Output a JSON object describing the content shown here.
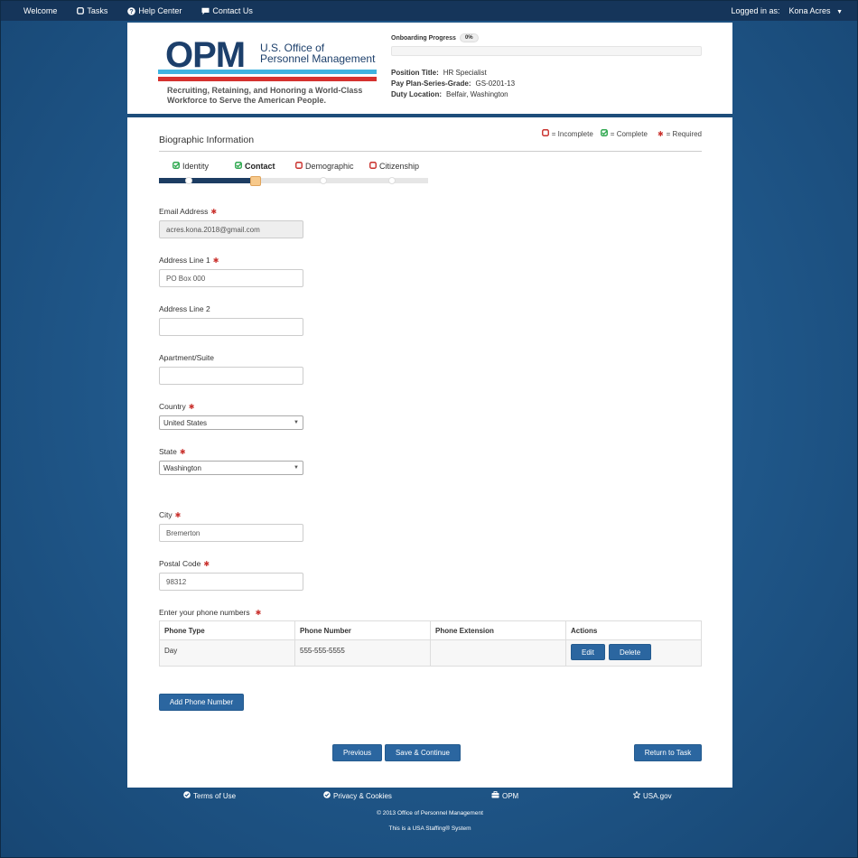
{
  "topbar": {
    "welcome": "Welcome",
    "tasks": "Tasks",
    "help_center": "Help Center",
    "contact_us": "Contact Us",
    "logged_in_label": "Logged in as:",
    "user_name": "Kona Acres"
  },
  "header": {
    "logo_text": "OPM",
    "agency_line1": "U.S. Office of",
    "agency_line2": "Personnel Management",
    "tagline_line1": "Recruiting, Retaining, and Honoring a World-Class",
    "tagline_line2": "Workforce to Serve the American People.",
    "progress_label": "Onboarding Progress",
    "progress_value": "0%",
    "progress_fraction": 0,
    "position_title_label": "Position Title:",
    "position_title": "HR Specialist",
    "pay_plan_label": "Pay Plan-Series-Grade:",
    "pay_plan": "GS-0201-13",
    "duty_location_label": "Duty Location:",
    "duty_location": "Belfair, Washington"
  },
  "section": {
    "title": "Biographic Information",
    "legend_incomplete": "= Incomplete",
    "legend_complete": "= Complete",
    "legend_required": "= Required"
  },
  "steps": [
    {
      "label": "Identity",
      "status": "complete"
    },
    {
      "label": "Contact",
      "status": "complete"
    },
    {
      "label": "Demographic",
      "status": "incomplete"
    },
    {
      "label": "Citizenship",
      "status": "incomplete"
    }
  ],
  "form": {
    "email_label": "Email Address",
    "email_value": "acres.kona.2018@gmail.com",
    "address1_label": "Address Line 1",
    "address1_value": "PO Box 000",
    "address2_label": "Address Line 2",
    "address2_value": "",
    "apt_label": "Apartment/Suite",
    "apt_value": "",
    "country_label": "Country",
    "country_value": "United States",
    "state_label": "State",
    "state_value": "Washington",
    "city_label": "City",
    "city_value": "Bremerton",
    "postal_label": "Postal Code",
    "postal_value": "98312",
    "required_mark": "✱"
  },
  "phones": {
    "label": "Enter your phone numbers",
    "columns": [
      "Phone Type",
      "Phone Number",
      "Phone Extension",
      "Actions"
    ],
    "rows": [
      {
        "type": "Day",
        "number": "555-555-5555",
        "extension": ""
      }
    ],
    "edit_label": "Edit",
    "delete_label": "Delete",
    "add_label": "Add Phone Number"
  },
  "nav_buttons": {
    "previous": "Previous",
    "save_continue": "Save & Continue",
    "return_task": "Return to Task"
  },
  "footer": {
    "terms": "Terms of Use",
    "privacy": "Privacy & Cookies",
    "opm": "OPM",
    "usagov": "USA.gov",
    "copyright": "© 2013 Office of Personnel Management",
    "system": "This is a USA Staffing® System"
  },
  "colors": {
    "navbar": "#15355a",
    "primary_button": "#2b66a0",
    "complete": "#2fa84f",
    "incomplete": "#c9302c"
  }
}
